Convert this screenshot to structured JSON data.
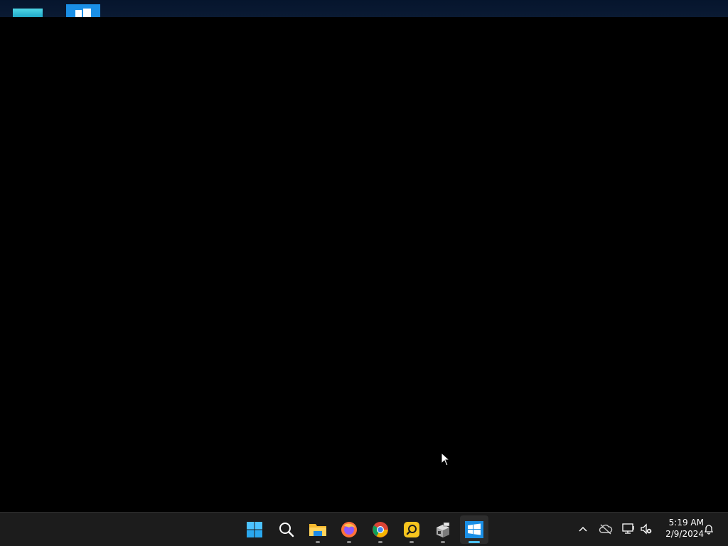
{
  "taskbar": {
    "apps": [
      {
        "name": "Start",
        "icon": "windows-start-icon",
        "running": false,
        "active": false
      },
      {
        "name": "Search",
        "icon": "search-icon",
        "running": false,
        "active": false
      },
      {
        "name": "File Explorer",
        "icon": "folder-icon",
        "running": true,
        "active": false
      },
      {
        "name": "Firefox",
        "icon": "firefox-icon",
        "running": true,
        "active": false
      },
      {
        "name": "Chrome",
        "icon": "chrome-icon",
        "running": true,
        "active": false
      },
      {
        "name": "Lens",
        "icon": "magnifier-app-icon",
        "running": true,
        "active": false
      },
      {
        "name": "Package",
        "icon": "installer-box-icon",
        "running": true,
        "active": false
      },
      {
        "name": "Windows Setup",
        "icon": "windows-logo-icon",
        "running": true,
        "active": true
      }
    ]
  },
  "tray": {
    "icons": [
      "chevron-up-icon",
      "cloud-offline-icon",
      "network-icon",
      "volume-muted-icon",
      "notification-bell-icon"
    ],
    "time": "5:19 AM",
    "date": "2/9/2024"
  },
  "colors": {
    "desktop_background": "#000000",
    "taskbar_background": "#1c1c1c",
    "accent": "#4cc2ff",
    "windows_blue": "#1a8fe6"
  }
}
